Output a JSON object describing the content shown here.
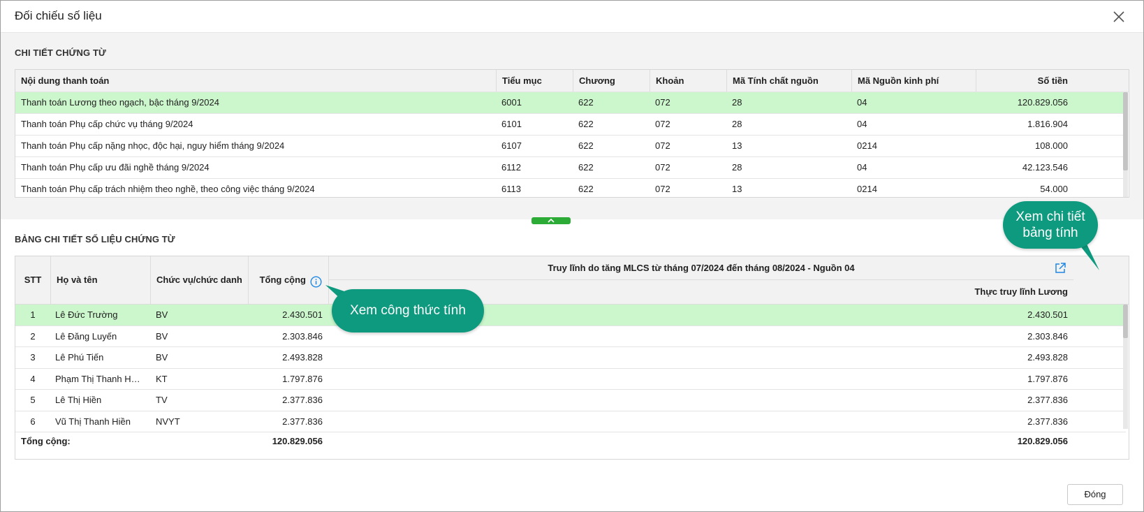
{
  "dialog": {
    "title": "Đối chiếu số liệu",
    "close_label": "Đóng"
  },
  "section1": {
    "title": "CHI TIẾT CHỨNG TỪ",
    "headers": [
      "Nội dung thanh toán",
      "Tiểu mục",
      "Chương",
      "Khoản",
      "Mã Tính chất nguồn",
      "Mã Nguồn kinh phí",
      "Số tiền"
    ],
    "rows": [
      [
        "Thanh toán Lương theo ngạch, bậc tháng 9/2024",
        "6001",
        "622",
        "072",
        "28",
        "04",
        "120.829.056"
      ],
      [
        "Thanh toán Phụ cấp chức vụ tháng 9/2024",
        "6101",
        "622",
        "072",
        "28",
        "04",
        "1.816.904"
      ],
      [
        "Thanh toán Phụ cấp nặng nhọc, độc hại, nguy hiểm tháng 9/2024",
        "6107",
        "622",
        "072",
        "13",
        "0214",
        "108.000"
      ],
      [
        "Thanh toán Phụ cấp ưu đãi nghề tháng 9/2024",
        "6112",
        "622",
        "072",
        "28",
        "04",
        "42.123.546"
      ],
      [
        "Thanh toán Phụ cấp trách nhiệm theo nghề, theo công việc tháng 9/2024",
        "6113",
        "622",
        "072",
        "13",
        "0214",
        "54.000"
      ]
    ]
  },
  "section2": {
    "title": "BẢNG CHI TIẾT SỐ LIỆU CHỨNG TỪ",
    "headers": {
      "stt": "STT",
      "name": "Họ và tên",
      "position": "Chức vụ/chức danh",
      "total": "Tổng cộng",
      "group": "Truy lĩnh do tăng MLCS từ tháng 07/2024 đến tháng 08/2024 - Nguồn 04",
      "sub": "Thực truy lĩnh Lương"
    },
    "rows": [
      [
        "1",
        "Lê Đức Trường",
        "BV",
        "2.430.501",
        "2.430.501"
      ],
      [
        "2",
        "Lê Đăng Luyến",
        "BV",
        "2.303.846",
        "2.303.846"
      ],
      [
        "3",
        "Lê Phú Tiến",
        "BV",
        "2.493.828",
        "2.493.828"
      ],
      [
        "4",
        "Phạm Thị Thanh Hườ...",
        "KT",
        "1.797.876",
        "1.797.876"
      ],
      [
        "5",
        "Lê Thị Hiền",
        "TV",
        "2.377.836",
        "2.377.836"
      ],
      [
        "6",
        "Vũ Thị Thanh Hiền",
        "NVYT",
        "2.377.836",
        "2.377.836"
      ]
    ],
    "footer": {
      "label": "Tổng cộng:",
      "total": "120.829.056",
      "sub_total": "120.829.056"
    }
  },
  "callouts": {
    "detail_sheet": "Xem chi tiết bảng tính",
    "formula": "Xem công thức tính"
  },
  "colors": {
    "selected_row": "#ccf7cc",
    "splitter": "#2cab37",
    "callout": "#0d9a7e",
    "link_icon": "#1e88e5"
  }
}
